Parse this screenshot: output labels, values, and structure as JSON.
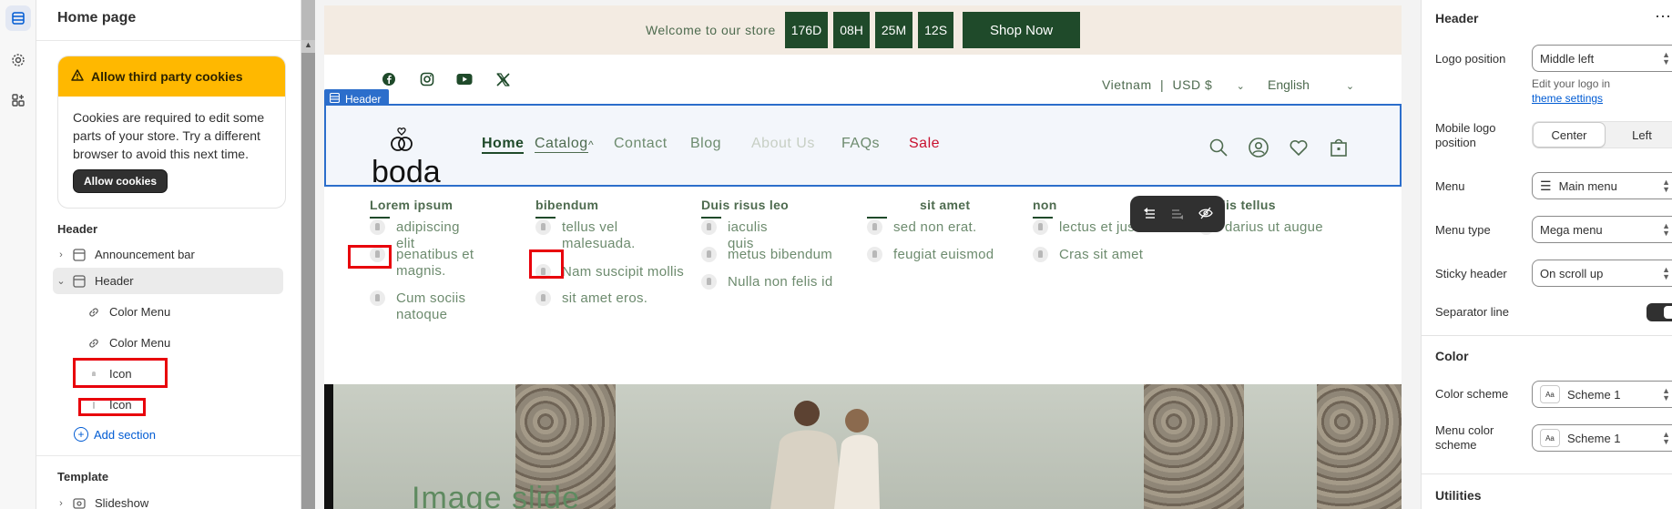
{
  "left_panel": {
    "title": "Home page",
    "cookie": {
      "title": "Allow third party cookies",
      "body": "Cookies are required to edit some parts of your store. Try a different browser to avoid this next time.",
      "button": "Allow cookies"
    },
    "header_section": "Header",
    "tree": [
      {
        "label": "Announcement bar"
      },
      {
        "label": "Header"
      },
      {
        "label": "Color Menu"
      },
      {
        "label": "Color Menu"
      },
      {
        "label": "Icon"
      },
      {
        "label": "Icon"
      }
    ],
    "add_section": "Add section",
    "template_section": "Template",
    "template_items": [
      {
        "label": "Slideshow"
      }
    ]
  },
  "site": {
    "announcement": {
      "text": "Welcome to our store",
      "countdown": [
        "176D",
        "08H",
        "25M",
        "12S"
      ],
      "button": "Shop Now"
    },
    "locale": {
      "country": "Vietnam",
      "sep": "|",
      "currency": "USD $",
      "language": "English"
    },
    "header_tag": "Header",
    "logo_text": "boda",
    "nav": [
      "Home",
      "Catalog",
      "Contact",
      "Blog",
      "About Us",
      "FAQs",
      "Sale"
    ],
    "mega_menu": [
      {
        "heading": "Lorem ipsum",
        "items": [
          "adipiscing elit",
          "penatibus et magnis.",
          "Cum sociis natoque"
        ]
      },
      {
        "heading": "bibendum",
        "items": [
          "tellus vel malesuada.",
          "Nam suscipit mollis",
          "sit amet eros."
        ]
      },
      {
        "heading": "Duis risus leo",
        "items": [
          "iaculis quis",
          "metus bibendum",
          "Nulla non felis id"
        ]
      },
      {
        "heading": "sit amet",
        "items": [
          "sed non erat.",
          "feugiat euismod"
        ]
      },
      {
        "heading": "non",
        "items": [
          "lectus et justo",
          "Cras sit amet"
        ]
      },
      {
        "heading": "mollis tellus",
        "items": [
          "darius ut augue"
        ]
      }
    ],
    "hero_text": "Image slide"
  },
  "right_panel": {
    "title": "Header",
    "more": "⋯",
    "logo_position": {
      "label": "Logo position",
      "value": "Middle left"
    },
    "logo_hint": "Edit your logo in",
    "logo_hint_link": "theme settings",
    "mobile_logo": {
      "label": "Mobile logo position",
      "options": [
        "Center",
        "Left"
      ],
      "selected": "Center"
    },
    "menu": {
      "label": "Menu",
      "value": "Main menu"
    },
    "menu_type": {
      "label": "Menu type",
      "value": "Mega menu"
    },
    "sticky": {
      "label": "Sticky header",
      "value": "On scroll up"
    },
    "separator": {
      "label": "Separator line",
      "on": true
    },
    "color_heading": "Color",
    "color_scheme": {
      "label": "Color scheme",
      "value": "Scheme 1"
    },
    "menu_color_scheme": {
      "label": "Menu color scheme",
      "value": "Scheme 1"
    },
    "utilities_heading": "Utilities",
    "scheme_icon_text": "Aa"
  },
  "colors": {
    "accent_blue": "#2c6ecb",
    "brand_green": "#1f4a2a",
    "sale_red": "#c8102e",
    "highlight_red": "#e8000b",
    "warning": "#ffb800"
  }
}
